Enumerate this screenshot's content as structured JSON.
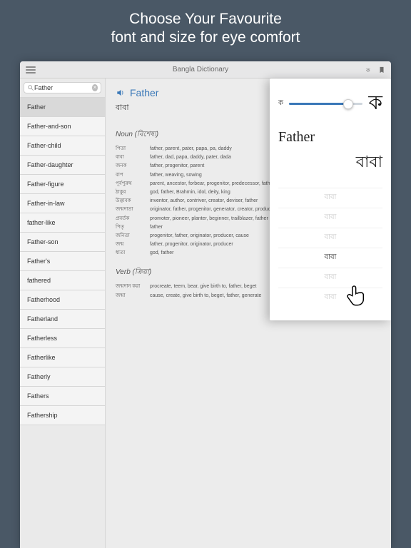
{
  "hero": {
    "line1": "Choose Your Favourite",
    "line2": "font and size for eye comfort"
  },
  "topbar": {
    "title": "Bangla Dictionary"
  },
  "search": {
    "value": "Father"
  },
  "wordlist": [
    "Father",
    "Father-and-son",
    "Father-child",
    "Father-daughter",
    "Father-figure",
    "Father-in-law",
    "father-like",
    "Father-son",
    "Father's",
    "fathered",
    "Fatherhood",
    "Fatherland",
    "Fatherless",
    "Fatherlike",
    "Fatherly",
    "Fathers",
    "Fathership"
  ],
  "selected_index": 0,
  "entry": {
    "headword": "Father",
    "bn": "বাবা",
    "noun_label": "Noun (বিশেষ্য)",
    "verb_label": "Verb (ক্রিয়া)",
    "noun": [
      {
        "bn": "পিতা",
        "en": "father, parent, pater, papa, pa, daddy"
      },
      {
        "bn": "বাবা",
        "en": "father, dad, papa, daddy, pater, dada"
      },
      {
        "bn": "জনক",
        "en": "father, progenitor, parent"
      },
      {
        "bn": "বাপ",
        "en": "father, weaving, sowing"
      },
      {
        "bn": "পূর্বপুরুষ",
        "en": "parent, ancestor, forbear, progenitor, predecessor, father"
      },
      {
        "bn": "ঠাকুর",
        "en": "god, father, Brahmin, idol, deity, king"
      },
      {
        "bn": "উদ্ভাবক",
        "en": "inventor, author, contriver, creator, deviser, father"
      },
      {
        "bn": "জন্মদাতা",
        "en": "originator, father, progenitor, generator, creator, producer"
      },
      {
        "bn": "প্রবর্তক",
        "en": "promoter, pioneer, planter, beginner, trailblazer, father"
      },
      {
        "bn": "পিতৃ",
        "en": "father"
      },
      {
        "bn": "জনিতা",
        "en": "progenitor, father, originator, producer, cause"
      },
      {
        "bn": "জন্ম",
        "en": "father, progenitor, originator, producer"
      },
      {
        "bn": "ধাতা",
        "en": "god, father"
      }
    ],
    "verb": [
      {
        "bn": "জন্মদান করা",
        "en": "procreate, teem, bear, give birth to, father, beget"
      },
      {
        "bn": "জন্মা",
        "en": "cause, create, give birth to, beget, father, generate"
      }
    ]
  },
  "panel": {
    "small_glyph": "ক",
    "big_glyph": "ক",
    "preview_en": "Father",
    "preview_bn": "বাবা",
    "options": [
      "বাবা",
      "বাবা",
      "বাবা",
      "বাবা",
      "বাবা",
      "বাবা"
    ],
    "selected_option_index": 3
  }
}
